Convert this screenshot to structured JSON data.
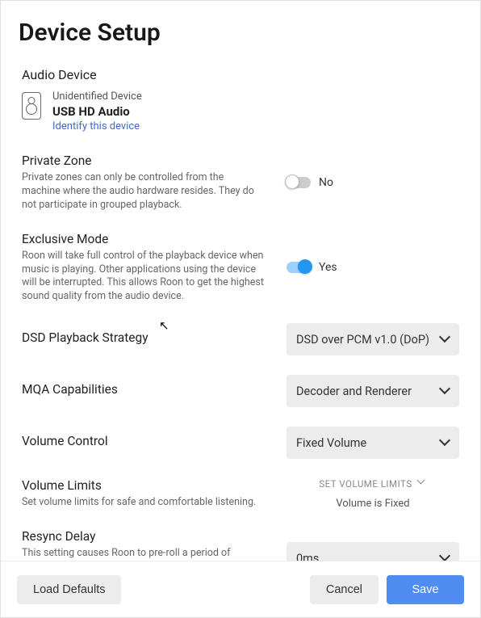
{
  "title": "Device Setup",
  "audio_device": {
    "heading": "Audio Device",
    "sub": "Unidentified Device",
    "name": "USB HD Audio",
    "identify": "Identify this device"
  },
  "private_zone": {
    "label": "Private Zone",
    "desc": "Private zones can only be controlled from the machine where the audio hardware resides. They do not participate in grouped playback.",
    "value": "No"
  },
  "exclusive_mode": {
    "label": "Exclusive Mode",
    "desc": "Roon will take full control of the playback device when music is playing. Other applications using the device will be interrupted. This allows Roon to get the highest sound quality from the audio device.",
    "value": "Yes"
  },
  "dsd": {
    "label": "DSD Playback Strategy",
    "value": "DSD over PCM v1.0 (DoP)"
  },
  "mqa": {
    "label": "MQA Capabilities",
    "value": "Decoder and Renderer"
  },
  "volume_control": {
    "label": "Volume Control",
    "value": "Fixed Volume"
  },
  "volume_limits": {
    "label": "Volume Limits",
    "desc": "Set volume limits for safe and comfortable listening.",
    "set": "SET VOLUME LIMITS",
    "status": "Volume is Fixed"
  },
  "resync": {
    "label": "Resync Delay",
    "desc": "This setting causes Roon to pre-roll a period of silence each time it switches formats. This gives hardware a",
    "value": "0ms"
  },
  "footer": {
    "defaults": "Load Defaults",
    "cancel": "Cancel",
    "save": "Save"
  }
}
